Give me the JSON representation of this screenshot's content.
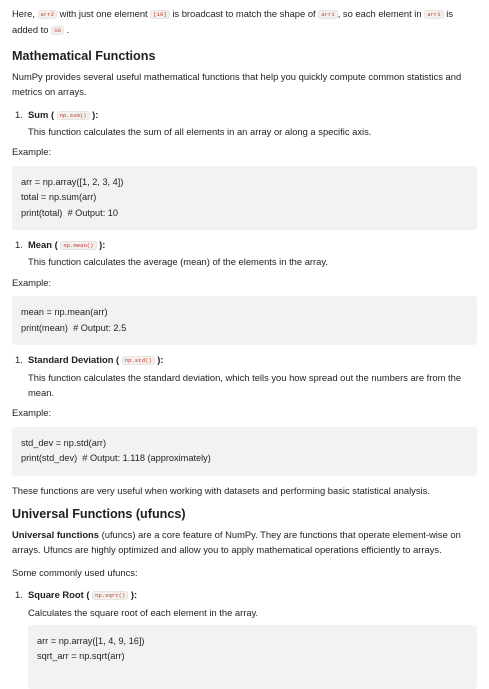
{
  "intro": {
    "t1": "Here,",
    "code_arr2": "arr2",
    "t2": "with just one element",
    "code_10a": "[10]",
    "t3": "is broadcast to match the shape of",
    "code_arr1a": "arr1",
    "t4": ", so each element in",
    "code_arr1b": "arr1",
    "t5": "is",
    "t6": "added to",
    "code_10b": "10",
    "t7": "."
  },
  "math": {
    "heading": "Mathematical Functions",
    "desc": "NumPy provides several useful mathematical functions that help you quickly compute common statistics and metrics on arrays.",
    "items": [
      {
        "num": "1.",
        "title": "Sum",
        "code": "np.sum()",
        "desc": "This function calculates the sum of all elements in an array or along a specific axis.",
        "example_label": "Example:",
        "code_lines": [
          "arr = np.array([1, 2, 3, 4])",
          "total = np.sum(arr)",
          "print(total)  # Output: 10"
        ]
      },
      {
        "num": "1.",
        "title": "Mean",
        "code": "np.mean()",
        "desc": "This function calculates the average (mean) of the elements in the array.",
        "example_label": "Example:",
        "code_lines": [
          "mean = np.mean(arr)",
          "print(mean)  # Output: 2.5"
        ]
      },
      {
        "num": "1.",
        "title": "Standard Deviation",
        "code": "np.std()",
        "desc": "This function calculates the standard deviation, which tells you how spread out the numbers are from the mean.",
        "example_label": "Example:",
        "code_lines": [
          "std_dev = np.std(arr)",
          "print(std_dev)  # Output: 1.118 (approximately)"
        ]
      }
    ],
    "summary": "These functions are very useful when working with datasets and performing basic statistical analysis."
  },
  "ufuncs": {
    "heading": "Universal Functions (ufuncs)",
    "desc_bold": "Universal functions",
    "desc_rest": " (ufuncs) are a core feature of NumPy. They are functions that operate element-wise on arrays. Ufuncs are highly optimized and allow you to apply mathematical operations efficiently to arrays.",
    "common_label": "Some commonly used ufuncs:",
    "items": [
      {
        "num": "1.",
        "title": "Square Root",
        "code": "np.sqrt()",
        "desc": "Calculates the square root of each element in the array.",
        "code_lines": [
          "arr = np.array([1, 4, 9, 16])",
          "sqrt_arr = np.sqrt(arr)"
        ]
      }
    ]
  }
}
